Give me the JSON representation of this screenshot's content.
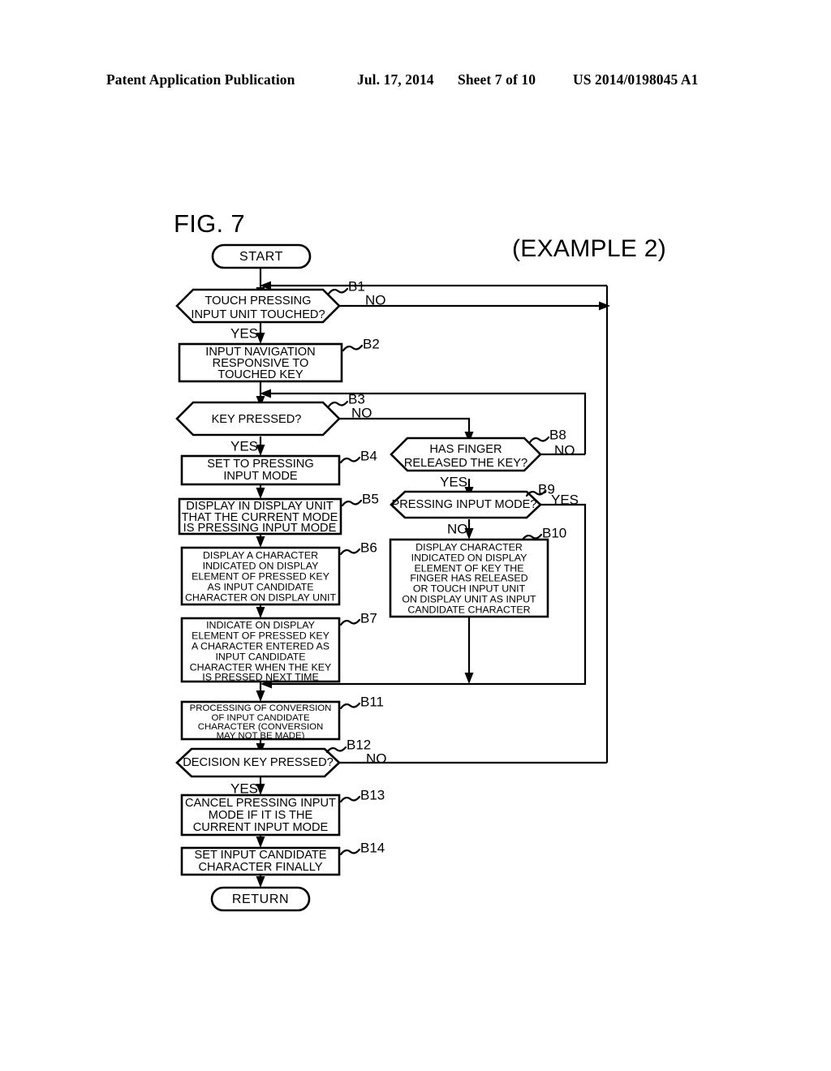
{
  "header": {
    "publication": "Patent Application Publication",
    "date": "Jul. 17, 2014",
    "sheet": "Sheet 7 of 10",
    "number": "US 2014/0198045 A1"
  },
  "figure": {
    "label": "FIG. 7",
    "example": "(EXAMPLE 2)"
  },
  "chart_data": {
    "type": "diagram",
    "title": "FIG. 7",
    "subtitle": "(EXAMPLE 2)",
    "nodes": [
      {
        "id": "START",
        "tag": "",
        "shape": "terminator",
        "lines": [
          "START"
        ]
      },
      {
        "id": "B1",
        "tag": "B1",
        "shape": "decision",
        "lines": [
          "TOUCH PRESSING",
          "INPUT UNIT TOUCHED?"
        ]
      },
      {
        "id": "B2",
        "tag": "B2",
        "shape": "process",
        "lines": [
          "INPUT NAVIGATION",
          "RESPONSIVE TO",
          "TOUCHED KEY"
        ]
      },
      {
        "id": "B3",
        "tag": "B3",
        "shape": "decision",
        "lines": [
          "KEY PRESSED?"
        ]
      },
      {
        "id": "B4",
        "tag": "B4",
        "shape": "process",
        "lines": [
          "SET TO PRESSING",
          "INPUT MODE"
        ]
      },
      {
        "id": "B5",
        "tag": "B5",
        "shape": "process",
        "lines": [
          "DISPLAY IN DISPLAY UNIT",
          "THAT THE CURRENT MODE",
          "IS PRESSING INPUT MODE"
        ]
      },
      {
        "id": "B6",
        "tag": "B6",
        "shape": "process",
        "lines": [
          "DISPLAY A CHARACTER",
          "INDICATED ON DISPLAY",
          "ELEMENT OF PRESSED KEY",
          "AS INPUT CANDIDATE",
          "CHARACTER ON DISPLAY UNIT"
        ]
      },
      {
        "id": "B7",
        "tag": "B7",
        "shape": "process",
        "lines": [
          "INDICATE ON DISPLAY",
          "ELEMENT OF PRESSED KEY",
          "A CHARACTER ENTERED AS",
          "INPUT CANDIDATE",
          "CHARACTER WHEN THE KEY",
          "IS PRESSED NEXT TIME"
        ]
      },
      {
        "id": "B8",
        "tag": "B8",
        "shape": "decision",
        "lines": [
          "HAS FINGER",
          "RELEASED THE KEY?"
        ]
      },
      {
        "id": "B9",
        "tag": "B9",
        "shape": "decision",
        "lines": [
          "PRESSING INPUT MODE?"
        ]
      },
      {
        "id": "B10",
        "tag": "B10",
        "shape": "process",
        "lines": [
          "DISPLAY CHARACTER",
          "INDICATED ON DISPLAY",
          "ELEMENT OF KEY THE",
          "FINGER HAS RELEASED",
          "OR TOUCH INPUT UNIT",
          "ON DISPLAY UNIT AS INPUT",
          "CANDIDATE CHARACTER"
        ]
      },
      {
        "id": "B11",
        "tag": "B11",
        "shape": "process",
        "lines": [
          "PROCESSING OF CONVERSION",
          "OF INPUT CANDIDATE",
          "CHARACTER (CONVERSION",
          "MAY NOT BE MADE)"
        ]
      },
      {
        "id": "B12",
        "tag": "B12",
        "shape": "decision",
        "lines": [
          "DECISION KEY PRESSED?"
        ]
      },
      {
        "id": "B13",
        "tag": "B13",
        "shape": "process",
        "lines": [
          "CANCEL PRESSING INPUT",
          "MODE IF IT IS THE",
          "CURRENT INPUT MODE"
        ]
      },
      {
        "id": "B14",
        "tag": "B14",
        "shape": "process",
        "lines": [
          "SET INPUT CANDIDATE",
          "CHARACTER FINALLY"
        ]
      },
      {
        "id": "RETURN",
        "tag": "",
        "shape": "terminator",
        "lines": [
          "RETURN"
        ]
      }
    ],
    "edges": [
      {
        "from": "START",
        "to": "B1",
        "label": ""
      },
      {
        "from": "B1",
        "to": "B2",
        "label": "YES"
      },
      {
        "from": "B1",
        "to": "B1",
        "label": "NO"
      },
      {
        "from": "B2",
        "to": "B3",
        "label": ""
      },
      {
        "from": "B3",
        "to": "B4",
        "label": "YES"
      },
      {
        "from": "B3",
        "to": "B8",
        "label": "NO"
      },
      {
        "from": "B4",
        "to": "B5",
        "label": ""
      },
      {
        "from": "B5",
        "to": "B6",
        "label": ""
      },
      {
        "from": "B6",
        "to": "B7",
        "label": ""
      },
      {
        "from": "B7",
        "to": "B11",
        "label": ""
      },
      {
        "from": "B8",
        "to": "B9",
        "label": "YES"
      },
      {
        "from": "B8",
        "to": "B3",
        "label": "NO"
      },
      {
        "from": "B9",
        "to": "B10",
        "label": "NO"
      },
      {
        "from": "B9",
        "to": "B1",
        "label": "YES"
      },
      {
        "from": "B10",
        "to": "B11",
        "label": ""
      },
      {
        "from": "B11",
        "to": "B12",
        "label": ""
      },
      {
        "from": "B12",
        "to": "B13",
        "label": "YES"
      },
      {
        "from": "B12",
        "to": "B1",
        "label": "NO"
      },
      {
        "from": "B13",
        "to": "B14",
        "label": ""
      },
      {
        "from": "B14",
        "to": "RETURN",
        "label": ""
      }
    ],
    "branch_labels": {
      "b1_yes": "YES",
      "b1_no": "NO",
      "b3_yes": "YES",
      "b3_no": "NO",
      "b8_yes": "YES",
      "b8_no": "NO",
      "b9_yes": "YES",
      "b9_no": "NO",
      "b12_yes": "YES",
      "b12_no": "NO"
    },
    "tags": {
      "b1": "B1",
      "b2": "B2",
      "b3": "B3",
      "b4": "B4",
      "b5": "B5",
      "b6": "B6",
      "b7": "B7",
      "b8": "B8",
      "b9": "B9",
      "b10": "B10",
      "b11": "B11",
      "b12": "B12",
      "b13": "B13",
      "b14": "B14"
    },
    "node_text": {
      "start": "START",
      "return": "RETURN",
      "b1_l1": "TOUCH PRESSING",
      "b1_l2": "INPUT UNIT TOUCHED?",
      "b2_l1": "INPUT NAVIGATION",
      "b2_l2": "RESPONSIVE TO",
      "b2_l3": "TOUCHED KEY",
      "b3_l1": "KEY PRESSED?",
      "b4_l1": "SET TO PRESSING",
      "b4_l2": "INPUT MODE",
      "b5_l1": "DISPLAY IN DISPLAY UNIT",
      "b5_l2": "THAT THE CURRENT MODE",
      "b5_l3": "IS PRESSING INPUT MODE",
      "b6_l1": "DISPLAY A CHARACTER",
      "b6_l2": "INDICATED ON DISPLAY",
      "b6_l3": "ELEMENT OF PRESSED KEY",
      "b6_l4": "AS INPUT CANDIDATE",
      "b6_l5": "CHARACTER ON DISPLAY UNIT",
      "b7_l1": "INDICATE ON DISPLAY",
      "b7_l2": "ELEMENT OF PRESSED KEY",
      "b7_l3": "A CHARACTER ENTERED AS",
      "b7_l4": "INPUT CANDIDATE",
      "b7_l5": "CHARACTER WHEN THE KEY",
      "b7_l6": "IS PRESSED NEXT TIME",
      "b8_l1": "HAS FINGER",
      "b8_l2": "RELEASED THE KEY?",
      "b9_l1": "PRESSING INPUT MODE?",
      "b10_l1": "DISPLAY CHARACTER",
      "b10_l2": "INDICATED ON DISPLAY",
      "b10_l3": "ELEMENT OF KEY THE",
      "b10_l4": "FINGER HAS RELEASED",
      "b10_l5": "OR TOUCH INPUT UNIT",
      "b10_l6": "ON DISPLAY UNIT AS INPUT",
      "b10_l7": "CANDIDATE CHARACTER",
      "b11_l1": "PROCESSING OF CONVERSION",
      "b11_l2": "OF INPUT CANDIDATE",
      "b11_l3": "CHARACTER (CONVERSION",
      "b11_l4": "MAY NOT BE MADE)",
      "b12_l1": "DECISION KEY PRESSED?",
      "b13_l1": "CANCEL PRESSING INPUT",
      "b13_l2": "MODE IF IT IS THE",
      "b13_l3": "CURRENT INPUT MODE",
      "b14_l1": "SET INPUT CANDIDATE",
      "b14_l2": "CHARACTER FINALLY"
    }
  }
}
